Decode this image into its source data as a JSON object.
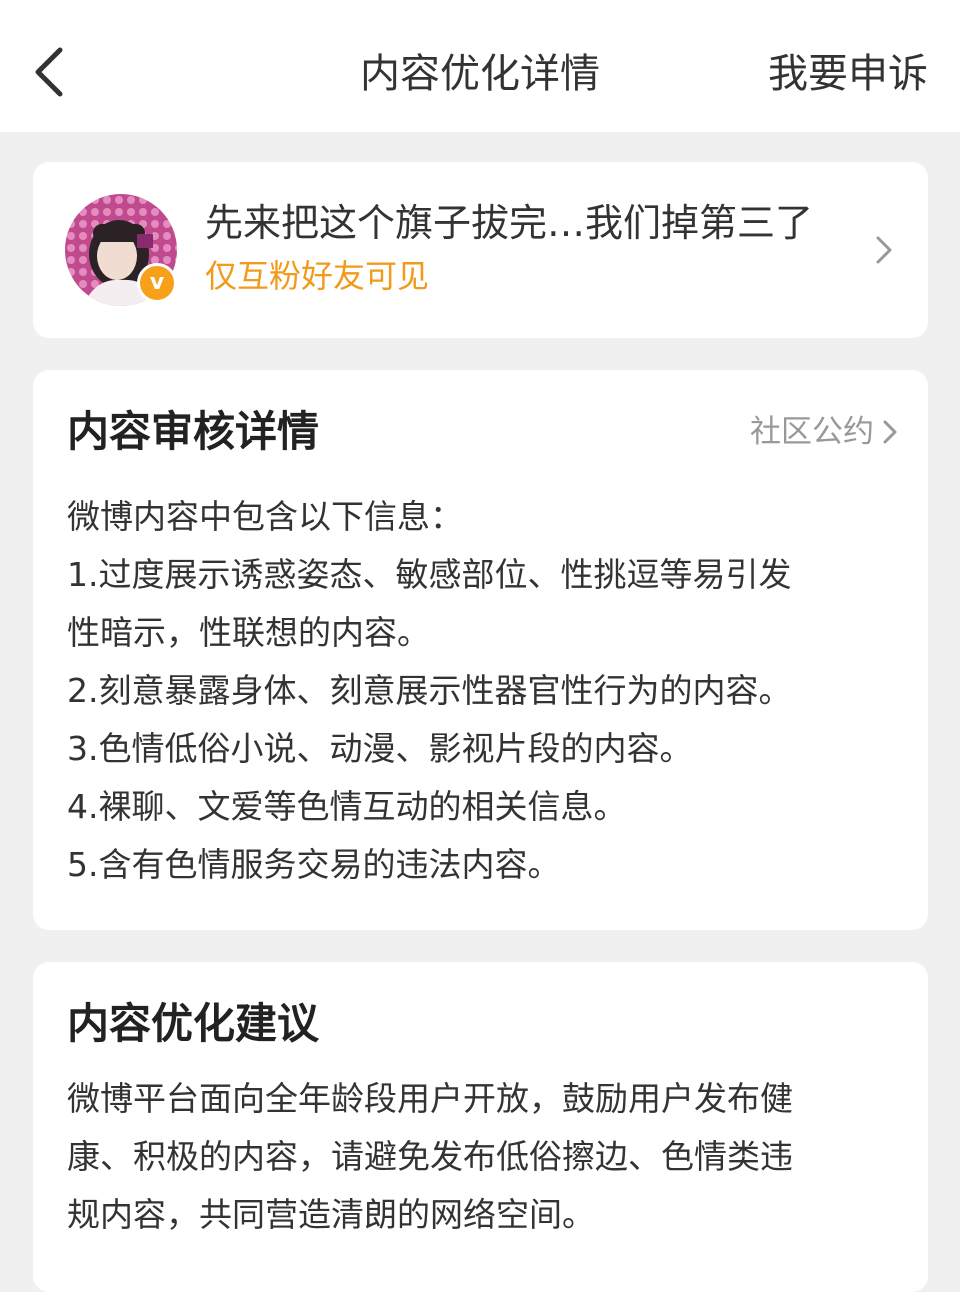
{
  "header": {
    "title": "内容优化详情",
    "appeal_label": "我要申诉",
    "back_icon": "back-chevron-icon"
  },
  "post": {
    "text": "先来把这个旗子拔完…我们掉第三了",
    "visibility": "仅互粉好友可见",
    "badge": "v",
    "accent_color": "#f29a1b"
  },
  "review": {
    "title": "内容审核详情",
    "convention_link": "社区公约",
    "lines": [
      "微博内容中包含以下信息：",
      "1.过度展示诱惑姿态、敏感部位、性挑逗等易引发",
      "性暗示，性联想的内容。",
      "2.刻意暴露身体、刻意展示性器官性行为的内容。",
      "3.色情低俗小说、动漫、影视片段的内容。",
      "4.裸聊、文爱等色情互动的相关信息。",
      "5.含有色情服务交易的违法内容。"
    ]
  },
  "suggestion": {
    "title": "内容优化建议",
    "lines": [
      "微博平台面向全年龄段用户开放，鼓励用户发布健",
      "康、积极的内容，请避免发布低俗擦边、色情类违",
      "规内容，共同营造清朗的网络空间。"
    ]
  }
}
